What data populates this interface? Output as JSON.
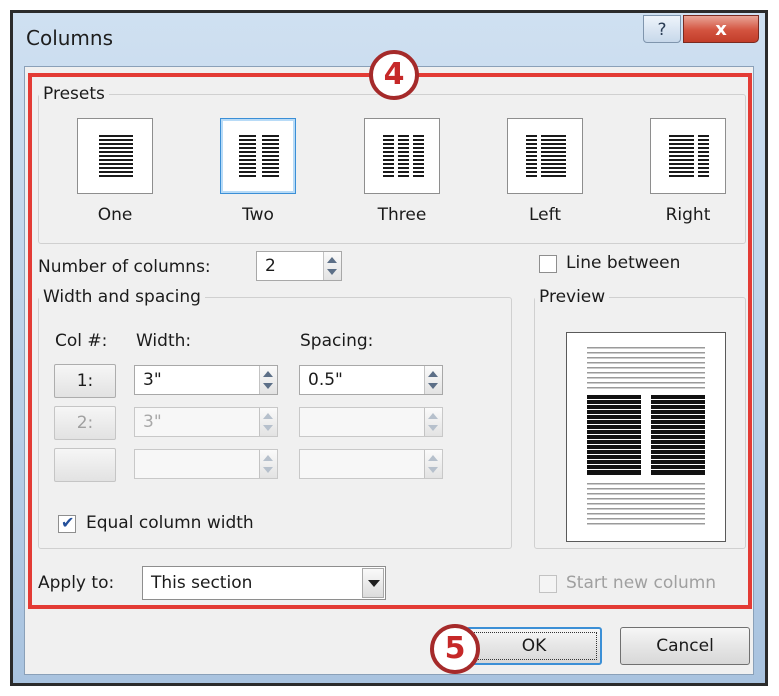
{
  "window": {
    "title": "Columns",
    "help_label": "?",
    "close_label": "x"
  },
  "presets": {
    "legend": "Presets",
    "items": [
      {
        "label": "One"
      },
      {
        "label": "Two"
      },
      {
        "label": "Three"
      },
      {
        "label": "Left"
      },
      {
        "label": "Right"
      }
    ],
    "selected": "Two"
  },
  "number_of_columns": {
    "label": "Number of columns:",
    "value": "2"
  },
  "line_between": {
    "label": "Line between",
    "checked": false
  },
  "width_spacing": {
    "legend": "Width and spacing",
    "col_header": "Col #:",
    "width_header": "Width:",
    "spacing_header": "Spacing:",
    "rows": [
      {
        "col": "1:",
        "width": "3\"",
        "spacing": "0.5\"",
        "enabled": true
      },
      {
        "col": "2:",
        "width": "3\"",
        "spacing": "",
        "enabled": false
      },
      {
        "col": "",
        "width": "",
        "spacing": "",
        "enabled": false
      }
    ],
    "equal_width": {
      "label": "Equal column width",
      "checked": true
    }
  },
  "preview": {
    "legend": "Preview"
  },
  "apply_to": {
    "label": "Apply to:",
    "value": "This section"
  },
  "start_new_column": {
    "label": "Start new column",
    "checked": false,
    "enabled": false
  },
  "buttons": {
    "ok": "OK",
    "cancel": "Cancel"
  },
  "callouts": {
    "step4": "4",
    "step5": "5"
  },
  "colors": {
    "highlight": "#e33b35",
    "callout_border": "#a52a2a",
    "selected_preset": "#3b8fd6"
  }
}
